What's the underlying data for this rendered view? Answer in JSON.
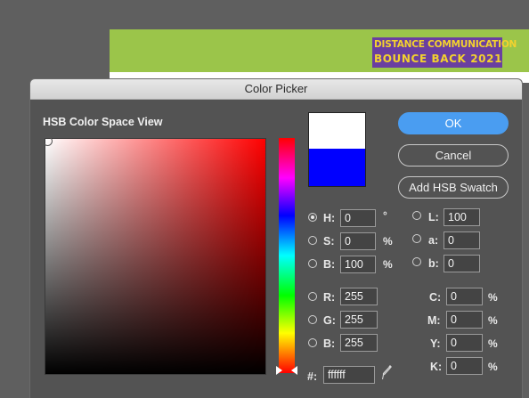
{
  "background": {
    "banner_line1": "DISTANCE COMMUNICATION",
    "banner_line2": "BOUNCE BACK 2021"
  },
  "dialog": {
    "title": "Color Picker",
    "view_label": "HSB Color Space View",
    "buttons": {
      "ok": "OK",
      "cancel": "Cancel",
      "add_swatch": "Add HSB Swatch"
    },
    "swatches": {
      "new_color": "#ffffff",
      "current_color": "#0000ff"
    },
    "hsb": {
      "h": {
        "label": "H:",
        "value": "0",
        "unit": "°"
      },
      "s": {
        "label": "S:",
        "value": "0",
        "unit": "%"
      },
      "b": {
        "label": "B:",
        "value": "100",
        "unit": "%"
      }
    },
    "lab": {
      "l": {
        "label": "L:",
        "value": "100"
      },
      "a": {
        "label": "a:",
        "value": "0"
      },
      "b": {
        "label": "b:",
        "value": "0"
      }
    },
    "rgb": {
      "r": {
        "label": "R:",
        "value": "255"
      },
      "g": {
        "label": "G:",
        "value": "255"
      },
      "b": {
        "label": "B:",
        "value": "255"
      }
    },
    "cmyk": {
      "c": {
        "label": "C:",
        "value": "0",
        "unit": "%"
      },
      "m": {
        "label": "M:",
        "value": "0",
        "unit": "%"
      },
      "y": {
        "label": "Y:",
        "value": "0",
        "unit": "%"
      },
      "k": {
        "label": "K:",
        "value": "0",
        "unit": "%"
      }
    },
    "hex": {
      "label": "#:",
      "value": "ffffff"
    },
    "icons": {
      "eyedropper": "eyedropper-icon"
    }
  }
}
